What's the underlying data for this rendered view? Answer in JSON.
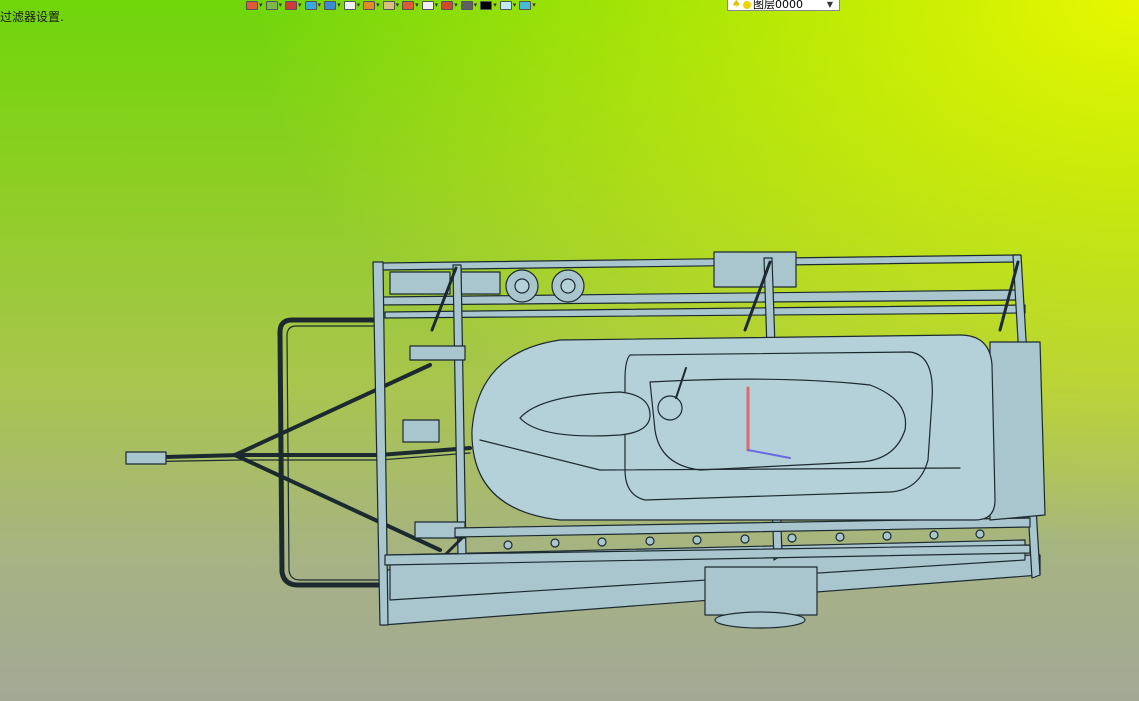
{
  "status_bar": {
    "text": "过滤器设置."
  },
  "toolbar": {
    "buttons": [
      {
        "icon": "sketch-icon",
        "color": "#e05a3a"
      },
      {
        "icon": "layers-icon",
        "color": "#7ab84a"
      },
      {
        "icon": "pencil-icon",
        "color": "#d03a3a"
      },
      {
        "icon": "cube-icon",
        "color": "#3aa8d8"
      },
      {
        "icon": "view-cube-icon",
        "color": "#3a8ad8"
      },
      {
        "icon": "box-icon",
        "color": "#f0f0f0"
      },
      {
        "icon": "section-icon",
        "color": "#e08a2a"
      },
      {
        "icon": "clipboard-icon",
        "color": "#d8c080"
      },
      {
        "icon": "origin-icon",
        "color": "#e05a3a"
      },
      {
        "icon": "sheet-icon",
        "color": "#f0f0f0"
      },
      {
        "icon": "frame-icon",
        "color": "#d04a2a"
      },
      {
        "icon": "display-icon",
        "color": "#606060"
      },
      {
        "icon": "color-icon",
        "color": "#000000"
      },
      {
        "icon": "material-icon",
        "color": "#bfe8f8"
      },
      {
        "icon": "appearance-icon",
        "color": "#4ab8d8"
      }
    ],
    "layer_select": {
      "value": "图层0000"
    }
  },
  "colors": {
    "model_fill": "#a9c6cf",
    "model_line": "#1c2a30",
    "hull_fill": "#b4d0d8"
  }
}
